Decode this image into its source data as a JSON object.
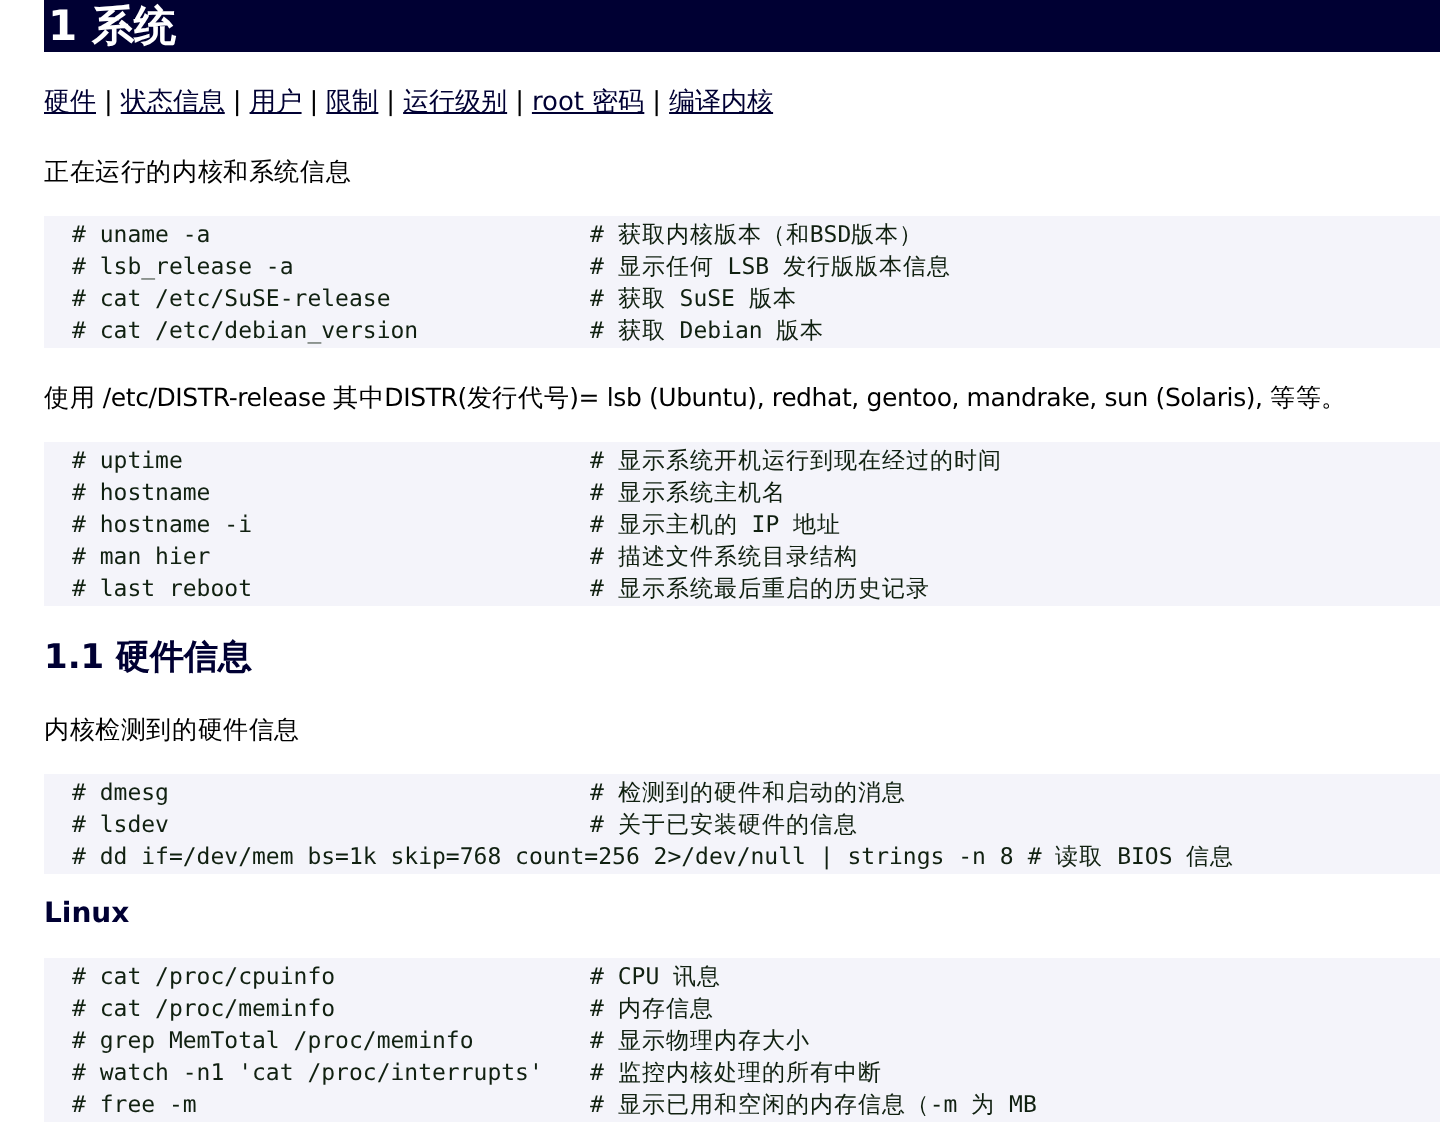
{
  "sections": [
    {
      "kind": "heading1",
      "text": "1 系统"
    },
    {
      "kind": "nav",
      "items": [
        {
          "kind": "link",
          "text": "硬件"
        },
        {
          "kind": "separator",
          "text": "|"
        },
        {
          "kind": "link",
          "text": "状态信息"
        },
        {
          "kind": "separator",
          "text": "|"
        },
        {
          "kind": "link",
          "text": "用户"
        },
        {
          "kind": "separator",
          "text": "|"
        },
        {
          "kind": "link",
          "text": "限制"
        },
        {
          "kind": "separator",
          "text": "|"
        },
        {
          "kind": "link",
          "text": "运行级别"
        },
        {
          "kind": "separator",
          "text": "|"
        },
        {
          "kind": "link",
          "text": "root 密码"
        },
        {
          "kind": "separator",
          "text": "|"
        },
        {
          "kind": "link",
          "text": "编译内核"
        }
      ]
    },
    {
      "kind": "paragraph",
      "text": "正在运行的内核和系统信息"
    },
    {
      "kind": "code",
      "lines": [
        {
          "kind": "aligned",
          "command": "# uname -a",
          "comment": "# 获取内核版本（和BSD版本）"
        },
        {
          "kind": "aligned",
          "command": "# lsb_release -a",
          "comment": "# 显示任何 LSB 发行版版本信息"
        },
        {
          "kind": "aligned",
          "command": "# cat /etc/SuSE-release",
          "comment": "# 获取 SuSE 版本"
        },
        {
          "kind": "aligned",
          "command": "# cat /etc/debian_version",
          "comment": "# 获取 Debian 版本"
        }
      ]
    },
    {
      "kind": "paragraph",
      "text": "使用 /etc/DISTR-release 其中DISTR(发行代号)= lsb (Ubuntu), redhat, gentoo, mandrake, sun (Solaris), 等等。"
    },
    {
      "kind": "code",
      "lines": [
        {
          "kind": "aligned",
          "command": "# uptime",
          "comment": "# 显示系统开机运行到现在经过的时间"
        },
        {
          "kind": "aligned",
          "command": "# hostname",
          "comment": "# 显示系统主机名"
        },
        {
          "kind": "aligned",
          "command": "# hostname -i",
          "comment": "# 显示主机的 IP 地址"
        },
        {
          "kind": "aligned",
          "command": "# man hier",
          "comment": "# 描述文件系统目录结构"
        },
        {
          "kind": "aligned",
          "command": "# last reboot",
          "comment": "# 显示系统最后重启的历史记录"
        }
      ]
    },
    {
      "kind": "heading2",
      "text": "1.1 硬件信息"
    },
    {
      "kind": "paragraph",
      "text": "内核检测到的硬件信息"
    },
    {
      "kind": "code",
      "lines": [
        {
          "kind": "aligned",
          "command": "# dmesg",
          "comment": "# 检测到的硬件和启动的消息"
        },
        {
          "kind": "aligned",
          "command": "# lsdev",
          "comment": "# 关于已安装硬件的信息"
        },
        {
          "kind": "inline",
          "command": "# dd if=/dev/mem bs=1k skip=768 count=256 2>/dev/null | strings -n 8",
          "comment": "# 读取 BIOS 信息"
        }
      ]
    },
    {
      "kind": "heading3",
      "text": "Linux"
    },
    {
      "kind": "code",
      "lines": [
        {
          "kind": "aligned",
          "command": "# cat /proc/cpuinfo",
          "comment": "# CPU 讯息"
        },
        {
          "kind": "aligned",
          "command": "# cat /proc/meminfo",
          "comment": "# 内存信息"
        },
        {
          "kind": "aligned",
          "command": "# grep MemTotal /proc/meminfo",
          "comment": "# 显示物理内存大小"
        },
        {
          "kind": "aligned",
          "command": "# watch -n1 'cat /proc/interrupts'",
          "comment": "# 监控内核处理的所有中断"
        },
        {
          "kind": "aligned",
          "command": "# free -m",
          "comment": "# 显示已用和空闲的内存信息（-m 为 MB"
        }
      ]
    }
  ]
}
